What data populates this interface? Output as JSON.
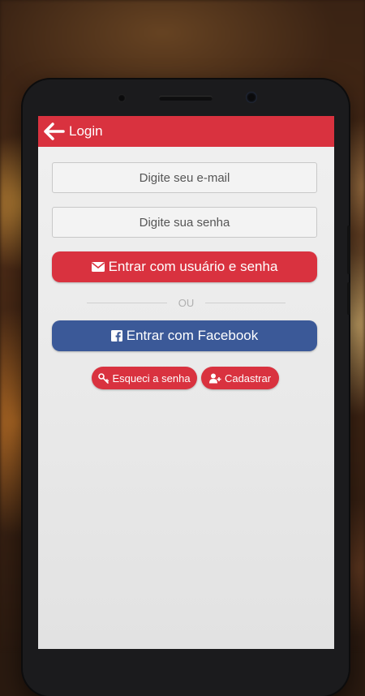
{
  "appbar": {
    "title": "Login",
    "back_icon": "arrow-left-icon"
  },
  "form": {
    "email_placeholder": "Digite seu e-mail",
    "password_placeholder": "Digite sua senha"
  },
  "buttons": {
    "login_label": "Entrar com usuário e senha",
    "login_icon": "envelope-icon",
    "divider_text": "OU",
    "facebook_label": "Entrar com Facebook",
    "facebook_icon": "facebook-icon",
    "forgot_label": "Esqueci a senha",
    "forgot_icon": "key-icon",
    "register_label": "Cadastrar",
    "register_icon": "user-plus-icon"
  },
  "colors": {
    "primary": "#d9323f",
    "facebook": "#3b5998"
  }
}
